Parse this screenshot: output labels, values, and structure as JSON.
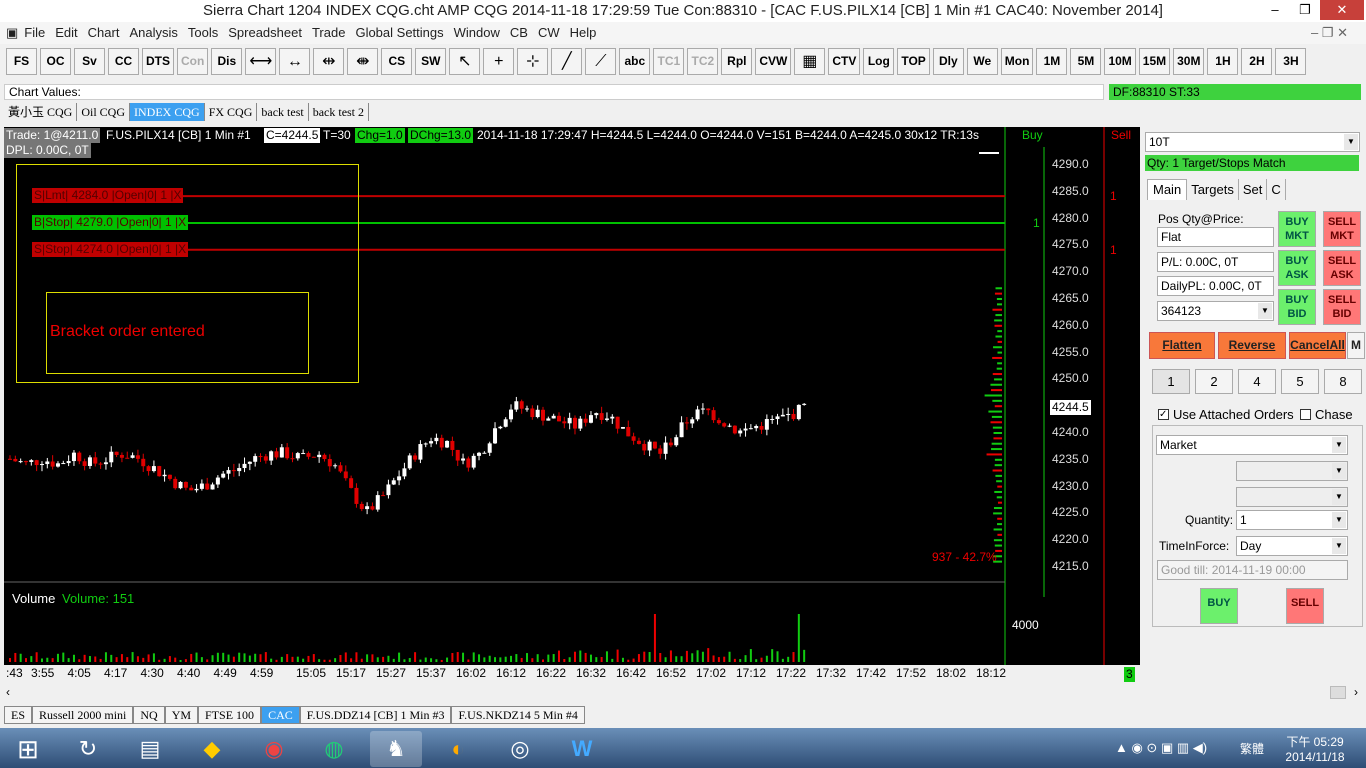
{
  "window": {
    "title": "Sierra Chart 1204 INDEX CQG.cht  AMP CQG 2014-11-18  17:29:59 Tue  Con:88310 - [CAC  F.US.PILX14 [CB]  1 Min  #1  CAC40: November 2014]"
  },
  "menu": [
    "File",
    "Edit",
    "Chart",
    "Analysis",
    "Tools",
    "Spreadsheet",
    "Trade",
    "Global Settings",
    "Window",
    "CB",
    "CW",
    "Help"
  ],
  "toolbar": [
    "FS",
    "OC",
    "Sv",
    "CC",
    "DTS",
    "Con",
    "Dis",
    "⟷",
    "↔",
    "⇹",
    "⇼",
    "CS",
    "SW",
    "↖",
    "+",
    "⊹",
    "╱",
    "⟋",
    "abc",
    "TC1",
    "TC2",
    "Rpl",
    "CVW",
    "▦",
    "CTV",
    "Log",
    "TOP",
    "Dly",
    "We",
    "Mon",
    "1M",
    "5M",
    "10M",
    "15M",
    "30M",
    "1H",
    "2H",
    "3H"
  ],
  "toolbar_disabled": [
    "Con",
    "TC1",
    "TC2"
  ],
  "chart_values": {
    "label": "Chart Values:",
    "df": "DF:88310  ST:33"
  },
  "chart_tabs": [
    "黃小玉 CQG",
    "Oil CQG",
    "INDEX CQG",
    "FX CQG",
    "back test",
    "back test 2"
  ],
  "chart_tabs_active": 2,
  "chart": {
    "trade": "Trade: 1@4211.0",
    "symbol": "F.US.PILX14 [CB]  1 Min   #1",
    "c": "C=4244.5",
    "t": "T=30",
    "chg": "Chg=1.0",
    "dchg": "DChg=13.0",
    "info": "2014-11-18 17:29:47 H=4244.5 L=4244.0 O=4244.0 V=151 B=4244.0 A=4245.0 30x12 TR:13s",
    "dpl": "DPL: 0.00C, 0T",
    "buy_label": "Buy",
    "sell_label": "Sell",
    "orders": [
      {
        "side": "S",
        "type": "Lmt",
        "price": "4284.0",
        "text": "S|Lmt| 4284.0 |Open|0| 1 |X",
        "color": "#c00000",
        "level": 4284,
        "qty_side": "sell",
        "qty": "1"
      },
      {
        "side": "B",
        "type": "Stop",
        "price": "4279.0",
        "text": "B|Stop| 4279.0 |Open|0| 1 |X",
        "color": "#00c000",
        "level": 4279,
        "qty_side": "buy",
        "qty": "1"
      },
      {
        "side": "S",
        "type": "Stop",
        "price": "4274.0",
        "text": "S|Stop| 4274.0 |Open|0| 1 |X",
        "color": "#c00000",
        "level": 4274,
        "qty_side": "sell",
        "qty": "1"
      }
    ],
    "message": "Bracket order entered",
    "price_labels": [
      "4290.0",
      "4285.0",
      "4280.0",
      "4275.0",
      "4270.0",
      "4265.0",
      "4260.0",
      "4255.0",
      "4250.0",
      "4244.5",
      "4240.0",
      "4235.0",
      "4230.0",
      "4225.0",
      "4220.0",
      "4215.0"
    ],
    "last_price": "4244.5",
    "range_text": "937 - 42.7%",
    "volume_label": "Volume",
    "volume_value": "Volume: 151",
    "volume_axis": "4000",
    "time_labels": [
      ":43",
      "3:55",
      "4:05",
      "4:17",
      "4:30",
      "4:40",
      "4:49",
      "4:59",
      "15:05",
      "15:17",
      "15:27",
      "15:37",
      "16:02",
      "16:12",
      "16:22",
      "16:32",
      "16:42",
      "16:52",
      "17:02",
      "17:12",
      "17:22",
      "17:32",
      "17:42",
      "17:52",
      "18:02",
      "18:12"
    ],
    "corner_badge": "3"
  },
  "chart_data": {
    "type": "candlestick",
    "ylim": [
      4212,
      4292
    ],
    "closes": [
      4235,
      4234,
      4235,
      4234,
      4236,
      4234,
      4235,
      4236,
      4235,
      4233,
      4231,
      4229,
      4230,
      4232,
      4233,
      4235,
      4236,
      4236,
      4235,
      4236,
      4234,
      4229,
      4225,
      4228,
      4232,
      4236,
      4239,
      4238,
      4234,
      4236,
      4241,
      4245,
      4244,
      4243,
      4242,
      4241,
      4244,
      4243,
      4240,
      4238,
      4236,
      4239,
      4243,
      4244,
      4242,
      4240,
      4241,
      4242,
      4243,
      4244.5
    ]
  },
  "panel": {
    "qty_select": "10T",
    "status": "Qty: 1 Target/Stops Match",
    "tabs": [
      "Main",
      "Targets",
      "Set",
      "C"
    ],
    "pos_label": "Pos Qty@Price:",
    "pos_value": "Flat",
    "pl": "P/L: 0.00C, 0T",
    "daily_pl": "DailyPL: 0.00C, 0T",
    "account": "364123",
    "buy_mkt": "BUY MKT",
    "sell_mkt": "SELL MKT",
    "buy_ask": "BUY ASK",
    "sell_ask": "SELL ASK",
    "buy_bid": "BUY BID",
    "sell_bid": "SELL BID",
    "flatten": "Flatten",
    "reverse": "Reverse",
    "cancel_all": "CancelAll",
    "m": "M",
    "qty_buttons": [
      "1",
      "2",
      "4",
      "5",
      "8"
    ],
    "use_attached": "Use Attached Orders",
    "chase": "Chase",
    "order_type": "Market",
    "quantity_label": "Quantity:",
    "quantity": "1",
    "tif_label": "TimeInForce:",
    "tif": "Day",
    "good_till": "Good till: 2014-11-19 00:00",
    "buy": "BUY",
    "sell": "SELL"
  },
  "bottom_tabs": [
    "ES",
    "Russell 2000 mini",
    "NQ",
    "YM",
    "FTSE 100",
    "CAC",
    "F.US.DDZ14 [CB]  1 Min  #3",
    "F.US.NKDZ14  5 Min  #4"
  ],
  "bottom_tabs_active": 5,
  "taskbar": {
    "lang": "繁體",
    "time": "下午 05:29",
    "date": "2014/11/18"
  },
  "colors": {
    "up": "#ffffff",
    "down": "#e00000",
    "buy": "#6cf06c",
    "sell": "#ff7777",
    "accent": "#3ca0f0"
  }
}
